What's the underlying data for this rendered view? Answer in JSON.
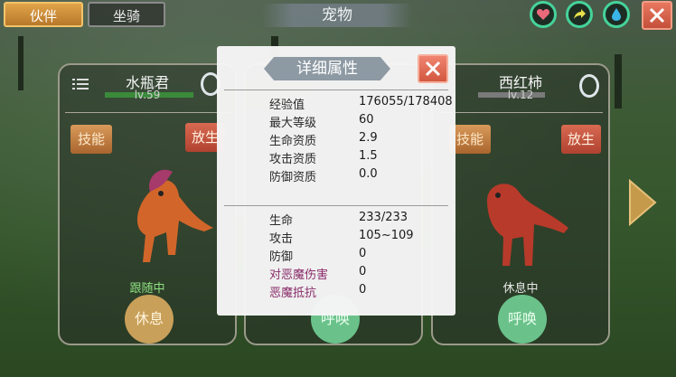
{
  "header": {
    "tab_partner": "伙伴",
    "tab_mount": "坐骑",
    "title": "宠物"
  },
  "top_icons": [
    {
      "icon": "heart-icon",
      "color": "#e86a7a"
    },
    {
      "icon": "share-arrow-icon",
      "color": "#e8e04a"
    },
    {
      "icon": "water-drop-icon",
      "color": "#3ab5e8"
    }
  ],
  "cards": [
    {
      "name": "水瓶君",
      "level": "lv.59",
      "skill_label": "技能",
      "release_label": "放生",
      "status": "跟随中",
      "action": "休息"
    },
    {
      "action": "呼唤"
    },
    {
      "name": "西红柿",
      "level": "lv.12",
      "skill_label": "技能",
      "release_label": "放生",
      "status": "休息中",
      "action": "呼唤"
    }
  ],
  "modal": {
    "title": "详细属性",
    "basic": [
      {
        "k": "经验值",
        "v": "176055/178408"
      },
      {
        "k": "最大等级",
        "v": "60"
      },
      {
        "k": "生命资质",
        "v": "2.9"
      },
      {
        "k": "攻击资质",
        "v": "1.5"
      },
      {
        "k": "防御资质",
        "v": "0.0"
      }
    ],
    "combat": [
      {
        "k": "生命",
        "v": "233/233"
      },
      {
        "k": "攻击",
        "v": "105~109"
      },
      {
        "k": "防御",
        "v": "0"
      },
      {
        "k": "对恶魔伤害",
        "v": "0",
        "special": true
      },
      {
        "k": "恶魔抵抗",
        "v": "0",
        "special": true
      }
    ]
  }
}
